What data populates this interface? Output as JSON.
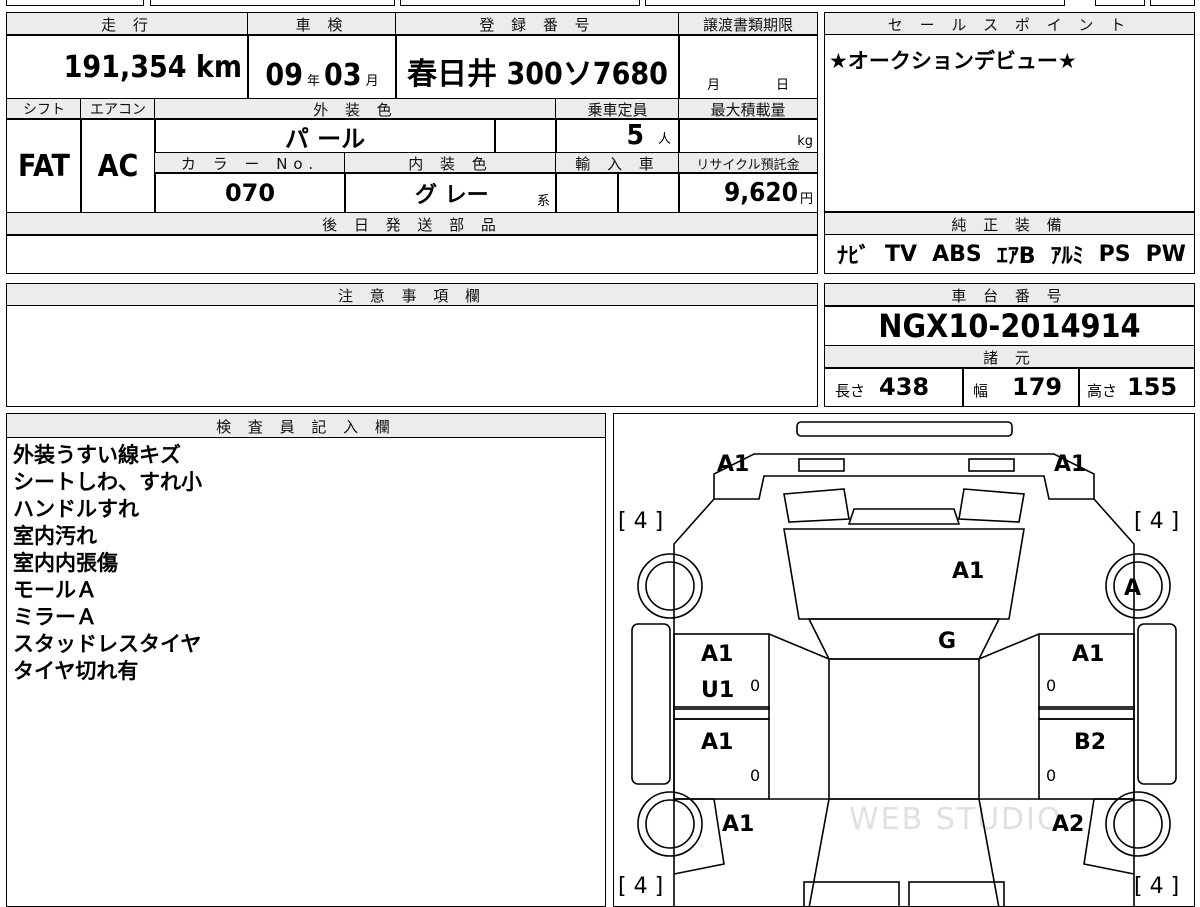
{
  "mileage": {
    "label": "走 行",
    "value": "191,354 km"
  },
  "inspection": {
    "label": "車 検",
    "year": "09",
    "year_unit": "年",
    "month": "03",
    "month_unit": "月"
  },
  "registration": {
    "label": "登 録 番 号",
    "value": "春日井 300ソ7680"
  },
  "transfer_deadline": {
    "label": "譲渡書類期限",
    "month_unit": "月",
    "day_unit": "日"
  },
  "sales_point": {
    "label": "セ ー ル ス ポ イ ン ト",
    "text": "★オークションデビュー★"
  },
  "shift": {
    "label": "シフト",
    "value": "FAT"
  },
  "aircon": {
    "label": "エアコン",
    "value": "AC"
  },
  "exterior_color": {
    "label": "外 装 色",
    "value": "パ ール"
  },
  "capacity": {
    "label": "乗車定員",
    "value": "5",
    "unit": "人"
  },
  "max_load": {
    "label": "最大積載量",
    "unit": "kg"
  },
  "color_no": {
    "label": "カ ラ ー No.",
    "value": "070"
  },
  "interior_color": {
    "label": "内 装 色",
    "value": "グ レー",
    "suffix": "系"
  },
  "import": {
    "label": "輸 入 車"
  },
  "recycle": {
    "label": "リサイクル預託金",
    "value": "9,620",
    "unit": "円"
  },
  "later_parts": {
    "label": "後 日 発 送 部 品"
  },
  "equipment": {
    "label": "純 正 装 備",
    "items": [
      "ﾅﾋﾞ",
      "TV",
      "ABS",
      "ｴｱB",
      "ｱﾙﾐ",
      "PS",
      "PW"
    ]
  },
  "caution": {
    "label": "注 意 事 項 欄"
  },
  "chassis": {
    "label": "車 台 番 号",
    "value": "NGX10-2014914"
  },
  "specs": {
    "label": "諸 元",
    "length_label": "長さ",
    "length": "438",
    "width_label": "幅",
    "width": "179",
    "height_label": "高さ",
    "height": "155"
  },
  "inspector": {
    "label": "検 査 員 記 入 欄",
    "notes": [
      "外装うすい線キズ",
      "シートしわ、すれ小",
      "ハンドルすれ",
      "室内汚れ",
      "室内内張傷",
      "モールＡ",
      "ミラーＡ",
      "スタッドレスタイヤ",
      "タイヤ切れ有"
    ]
  },
  "diagram": {
    "tire_tl": "[ 4 ]",
    "tire_tr": "[ 4 ]",
    "tire_bl": "[ 4 ]",
    "tire_br": "[ 4 ]",
    "front_left": "A1",
    "front_right": "A1",
    "hood": "A1",
    "roof": "G",
    "right_wheel_front": "A",
    "left_front_door": "A1",
    "left_front_door_2": "U1",
    "right_front_door": "A1",
    "left_rear_door": "A1",
    "right_rear_door": "B2",
    "left_rear": "A1",
    "right_rear": "A2",
    "zero_1": "0",
    "zero_2": "0",
    "zero_3": "0",
    "zero_4": "0",
    "watermark": "WEB STUDIO"
  }
}
